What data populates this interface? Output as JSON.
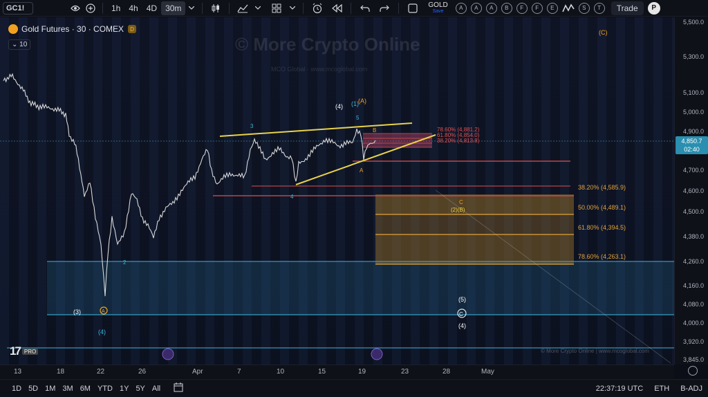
{
  "toolbar": {
    "symbol": "GC1!",
    "intervals": [
      "1h",
      "4h",
      "4D",
      "30m"
    ],
    "active_interval": "30m",
    "gold_label": "GOLD",
    "save_label": "Save",
    "letter_buttons": [
      "A",
      "A",
      "A",
      "B",
      "F",
      "F",
      "E",
      "S",
      "T"
    ],
    "trade_label": "Trade",
    "profile_letter": "P"
  },
  "legend": {
    "title": "Gold Futures · 30 · COMEX",
    "badge": "D",
    "volume_value": "10"
  },
  "watermarks": {
    "main": "© More Crypto Online",
    "sub": "MCO Global · www.mcoglobal.com",
    "footer": "© More Crypto Online  |  www.mcoglobal.com"
  },
  "tv_logo": {
    "mark": "17",
    "pro": "PRO"
  },
  "price_scale": {
    "labels": [
      "5,500.0",
      "5,300.0",
      "5,100.0",
      "5,000.0",
      "4,900.0",
      "4,700.0",
      "4,600.0",
      "4,500.0",
      "4,380.0",
      "4,260.0",
      "4,160.0",
      "4,080.0",
      "4,000.0",
      "3,920.0",
      "3,845.0"
    ],
    "current_price": "4,850.7",
    "current_time": "02:40"
  },
  "time_scale": {
    "labels": [
      "13",
      "18",
      "22",
      "26",
      "Apr",
      "7",
      "10",
      "15",
      "19",
      "23",
      "28",
      "May"
    ]
  },
  "fib_levels": [
    {
      "label": "38.20% (4,585.9)"
    },
    {
      "label": "50.00% (4,489.1)"
    },
    {
      "label": "61.80% (4,394.5)"
    },
    {
      "label": "78.60% (4,263.1)"
    }
  ],
  "top_fib_levels": [
    {
      "label": "78.60% (4,881.2)"
    },
    {
      "label": "61.80% (4,854.0)"
    },
    {
      "label": "38.20% (4,813.8)"
    }
  ],
  "wave_labels": {
    "c_top": "(C)",
    "w4_top": "(4)",
    "w1a": "(1)",
    "wa": "(A)",
    "w3": "3",
    "w5": "5",
    "wb_small": "B",
    "wa_small": "A",
    "w4_small": "4",
    "wc": "C",
    "w2b": "(2)(B)",
    "w2": "2",
    "w3_paren": "(3)",
    "wa_circle": "A",
    "w4_paren": "(4)",
    "w5_paren": "(5)",
    "wc_circle": "C",
    "w4_paren2": "(4)"
  },
  "bottom_bar": {
    "ranges": [
      "1D",
      "5D",
      "1M",
      "3M",
      "6M",
      "YTD",
      "1Y",
      "5Y",
      "All"
    ],
    "clock": "22:37:19 UTC",
    "session": "ETH",
    "adj": "B-ADJ"
  },
  "colors": {
    "trendline": "#e8d24a",
    "fib_line": "#e05050",
    "zone": "#b8862a",
    "cyan": "#3fb3d9",
    "orange": "#f0a020"
  }
}
